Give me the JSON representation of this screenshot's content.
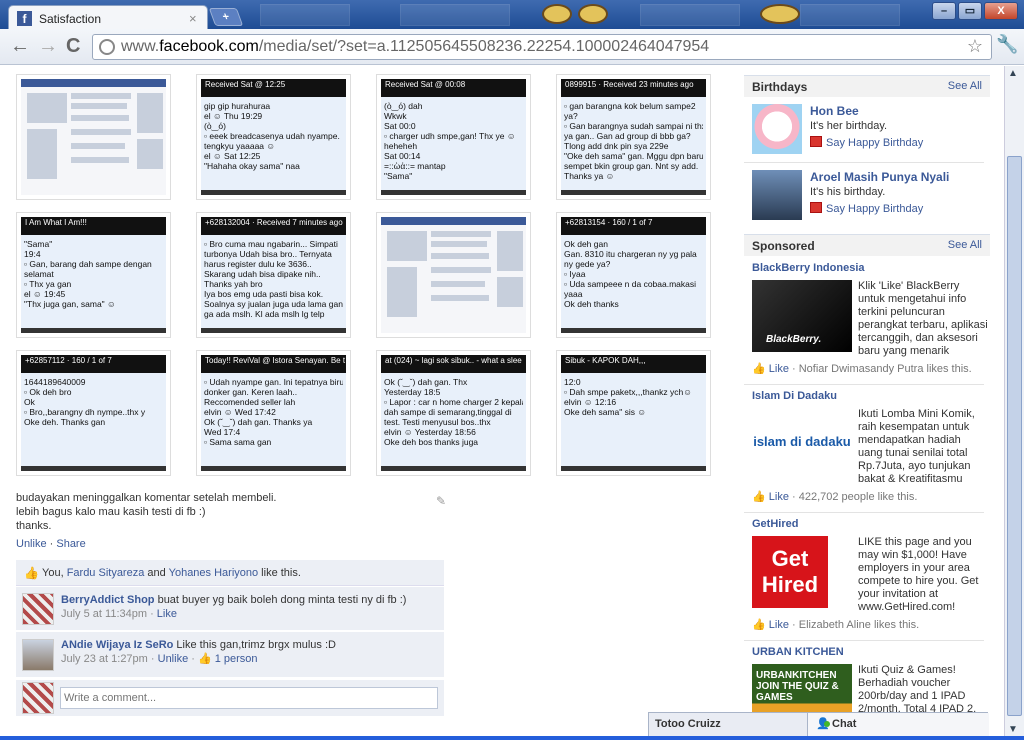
{
  "browser": {
    "tab_title": "Satisfaction",
    "tab_close": "×",
    "new_tab": "+",
    "url_prefix": "www.",
    "url_domain": "facebook.com",
    "url_path": "/media/set/?set=a.112505645508236.22254.100002464047954",
    "window_buttons": [
      "–",
      "▭",
      "X"
    ]
  },
  "photos": [
    {
      "kind": "fb",
      "bar": "",
      "lines": []
    },
    {
      "kind": "chat",
      "bar": "Received Sat @ 12:25",
      "lines": [
        "gip gip hurahuraa",
        "el ☺ Thu 19:29",
        "(ὸ‿ό)",
        "▫ eeek breadcasenya udah nyampe.",
        "tengkyu yaaaaa ☺",
        "el ☺ Sat 12:25",
        "\"Hahaha okay sama\" naa"
      ]
    },
    {
      "kind": "chat",
      "bar": "Received Sat @ 00:08",
      "lines": [
        "(ὸ‿ό) dah",
        "Wkwk",
        "Sat 00:0",
        "▫ charger udh smpe,gan! Thx ye ☺",
        "heheheh",
        "Sat 00:14",
        "=::ὼἀ::= mantap",
        "\"Sama\""
      ]
    },
    {
      "kind": "chat",
      "bar": "0899915 · Received 23 minutes ago",
      "lines": [
        "▫ gan barangna kok belum sampe2",
        "ya?",
        "▫ Gan barangnya sudah sampai ni thx",
        "ya gan.. Gan ad group di bbb ga?",
        "Tlong add dnk pin sya 229e",
        "\"Oke deh sama\" gan. Mggu dpn baru",
        "sempet bkin group gan. Nnt sy add.",
        "Thanks ya ☺"
      ]
    },
    {
      "kind": "chat",
      "bar": "I Am What I Am!!!",
      "lines": [
        "\"Sama\"",
        "19:4",
        "▫ Gan, barang dah sampe dengan",
        "selamat",
        "▫ Thx ya gan",
        "el ☺ 19:45",
        "\"Thx juga gan, sama\" ☺"
      ]
    },
    {
      "kind": "chat",
      "bar": "+628132004 · Received 7 minutes ago",
      "lines": [
        "▫ Bro cuma mau ngabarin... Simpati",
        "turbonya Udah bisa bro.. Ternyata",
        "harus register dulu ke 3636..",
        "Skarang udah bisa dipake nih..",
        "Thanks yah bro",
        "Iya bos emg uda pasti bisa kok.",
        "Soalnya sy jualan juga uda lama gan",
        "ga ada mslh. Kl ada mslh lg telp"
      ]
    },
    {
      "kind": "fb",
      "bar": "",
      "lines": []
    },
    {
      "kind": "chat",
      "bar": "+62813154 · 160 / 1 of 7",
      "lines": [
        "Ok deh gan",
        "Gan. 8310 itu chargeran ny yg pala",
        "ny gede ya?",
        "▫ Iyaa",
        "▫ Uda sampeee n da cobaa.makasi",
        "yaaa",
        "Ok deh thanks"
      ]
    },
    {
      "kind": "chat",
      "bar": "+62857112 · 160 / 1 of 7",
      "lines": [
        "1644189640009",
        "▫ Ok deh bro",
        "Ok",
        "▫ Bro,,barangny dh nympe..thx y",
        "Oke deh. Thanks gan"
      ]
    },
    {
      "kind": "chat",
      "bar": "Today!! ReviVal @ Istora Senayan. Be t",
      "lines": [
        "▫ Udah nyampe gan. Ini tepatnya biru",
        "donker gan. Keren laah..",
        "Reccomended seller lah",
        "elvin ☺ Wed 17:42",
        "Ok (ˇ‿ˇ) dah gan. Thanks ya",
        "Wed 17:4",
        "▫ Sama sama gan"
      ]
    },
    {
      "kind": "chat",
      "bar": "at (024) ~ lagi sok sibuk.. - what a slee",
      "lines": [
        "Ok (ˇ‿ˇ) dah gan. Thx",
        "Yesterday 18:5",
        "▫ Lapor : car n home charger 2 kepala",
        "dah sampe di semarang,tinggal di",
        "test. Testi menyusul bos..thx",
        "elvin ☺ Yesterday 18:56",
        "Oke deh bos thanks juga"
      ]
    },
    {
      "kind": "chat",
      "bar": "Sibuk - KAPOK DAH,,,",
      "lines": [
        "12:0",
        "▫ Dah smpe paketx,,,thankz ych☺",
        "elvin ☺ 12:16",
        "Oke deh sama\" sis ☺"
      ]
    }
  ],
  "post": {
    "caption_lines": [
      "budayakan meninggalkan komentar setelah membeli.",
      "lebih bagus kalo mau kasih testi di fb :)",
      "thanks."
    ],
    "unlike": "Unlike",
    "sep": " · ",
    "share": "Share",
    "likes_you": "You, ",
    "like_name1": "Fardu Sityareza",
    "likes_and": " and ",
    "like_name2": "Yohanes Hariyono",
    "likes_suffix": " like this."
  },
  "comments": [
    {
      "name": "BerryAddict Shop",
      "text": " buat buyer yg baik boleh dong minta testi ny di fb :)",
      "time": "July 5 at 11:34pm",
      "actions": [
        " · ",
        "Like"
      ]
    },
    {
      "name": "ANdie Wijaya Iz SeRo",
      "text": " Like this gan,trimz brgx mulus :D",
      "time": "July 23 at 1:27pm",
      "actions": [
        " · ",
        "Unlike",
        " · ",
        "👍 1 person"
      ]
    }
  ],
  "write_comment_placeholder": "Write a comment...",
  "birthdays": {
    "title": "Birthdays",
    "see_all": "See All",
    "items": [
      {
        "name": "Hon Bee",
        "sub": "It's her birthday.",
        "action": "Say Happy Birthday"
      },
      {
        "name": "Aroel Masih Punya Nyali",
        "sub": "It's his birthday.",
        "action": "Say Happy Birthday"
      }
    ]
  },
  "sponsored": {
    "title": "Sponsored",
    "see_all": "See All",
    "ads": [
      {
        "title": "BlackBerry Indonesia",
        "text": "Klik 'Like' BlackBerry untuk mengetahui info terkini peluncuran perangkat terbaru, aplikasi tercanggih, dan aksesori baru yang menarik",
        "like": "Like",
        "like_suffix": " · Nofiar Dwimasandy Putra likes this.",
        "img_text": "BlackBerry."
      },
      {
        "title": "Islam Di Dadaku",
        "text": "Ikuti Lomba Mini Komik, raih kesempatan untuk mendapatkan hadiah uang tunai senilai total Rp.7Juta, ayo tunjukan bakat & Kreatifitasmu",
        "like": "Like",
        "like_suffix": " · 422,702 people like this.",
        "img_text": "islam di dadaku"
      },
      {
        "title": "GetHired",
        "text": "LIKE this page and you may win $1,000! Have employers in your area compete to hire you. Get your invitation at www.GetHired.com!",
        "like": "Like",
        "like_suffix": " · Elizabeth Aline likes this.",
        "img_text": "Get Hired"
      },
      {
        "title": "URBAN KITCHEN",
        "text": "Ikuti Quiz & Games! Berhadiah voucher 200rb/day and 1 IPAD 2/month. Total 4 IPAD 2.",
        "like": "",
        "like_suffix": "",
        "img_text": "URBANKITCHEN JOIN THE QUIZ & GAMES"
      }
    ]
  },
  "chat": {
    "contact": "Totoo Cruizz",
    "label": "Chat"
  }
}
